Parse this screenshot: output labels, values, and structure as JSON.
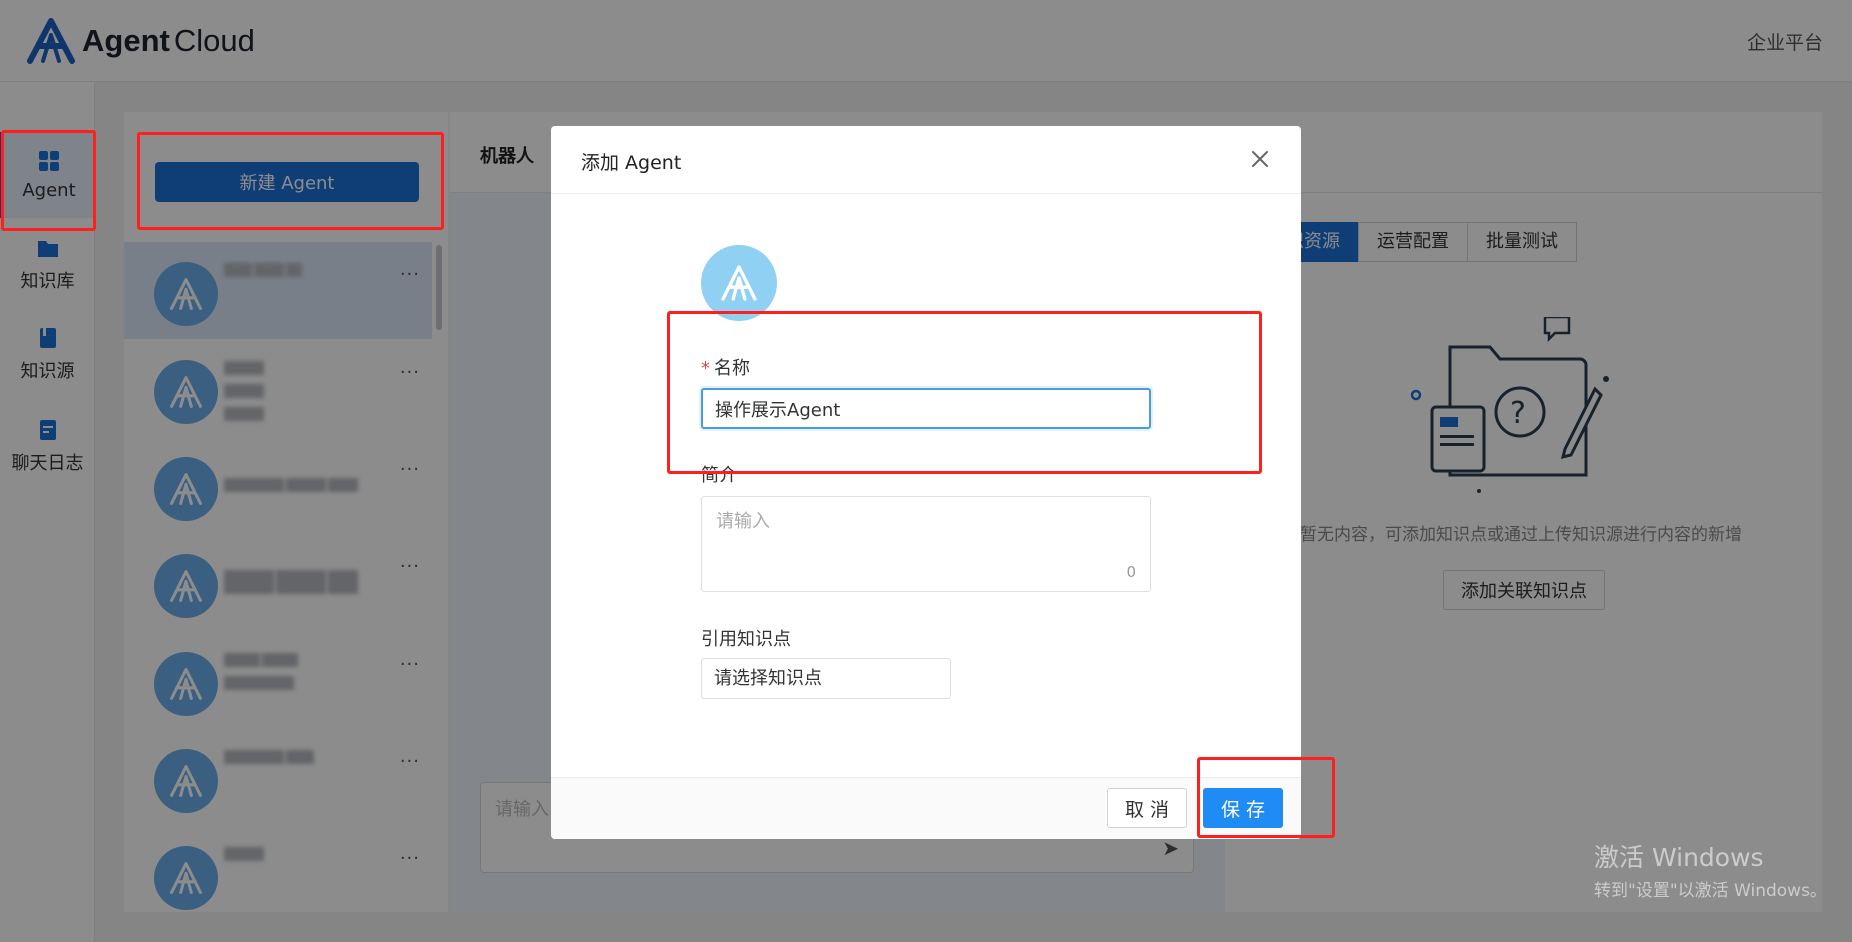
{
  "header": {
    "brand_bold": "Agent",
    "brand_light": "Cloud",
    "platform_link": "企业平台"
  },
  "nav": {
    "items": [
      {
        "label": "Agent",
        "icon": "grid-icon",
        "active": true
      },
      {
        "label": "知识库",
        "icon": "folder-icon",
        "active": false
      },
      {
        "label": "知识源",
        "icon": "book-icon",
        "active": false
      },
      {
        "label": "聊天日志",
        "icon": "log-icon",
        "active": false
      }
    ]
  },
  "agent_list": {
    "new_button": "新建 Agent",
    "more": "···",
    "items": [
      "",
      "",
      "",
      "",
      "",
      "",
      ""
    ]
  },
  "chat": {
    "title": "机器人",
    "input_placeholder": "请输入..."
  },
  "knowledge": {
    "tabs": [
      "识资源",
      "运营配置",
      "批量测试"
    ],
    "active_tab": 0,
    "empty_text": "暂无内容，可添加知识点或通过上传知识源进行内容的新增",
    "add_button": "添加关联知识点"
  },
  "modal": {
    "title": "添加 Agent",
    "required_mark": "*",
    "name_label": "名称",
    "name_value": "操作展示Agent",
    "intro_label": "简介",
    "intro_placeholder": "请输入",
    "intro_count": "0",
    "ref_label": "引用知识点",
    "ref_placeholder": "请选择知识点",
    "cancel": "取 消",
    "save": "保 存"
  },
  "watermark": {
    "line1": "激活 Windows",
    "line2": "转到\"设置\"以激活 Windows。"
  },
  "colors": {
    "primary": "#1c6fd8",
    "save": "#1f8bf5",
    "highlight": "#ff1f1f",
    "avatar": "#6aaee9"
  }
}
